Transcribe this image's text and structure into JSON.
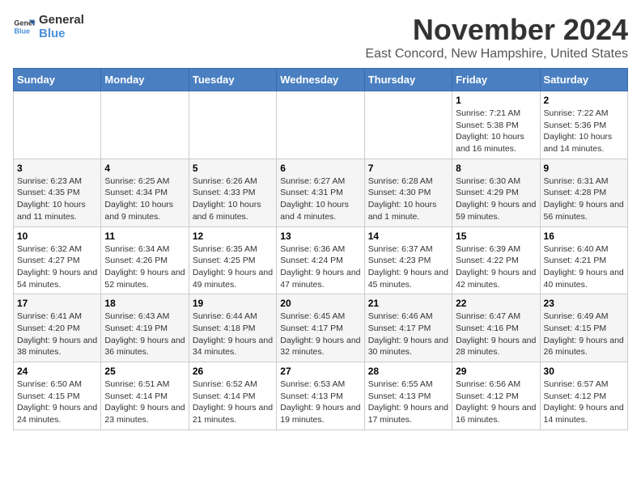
{
  "logo": {
    "line1": "General",
    "line2": "Blue"
  },
  "title": "November 2024",
  "location": "East Concord, New Hampshire, United States",
  "days_of_week": [
    "Sunday",
    "Monday",
    "Tuesday",
    "Wednesday",
    "Thursday",
    "Friday",
    "Saturday"
  ],
  "weeks": [
    [
      {
        "day": "",
        "info": ""
      },
      {
        "day": "",
        "info": ""
      },
      {
        "day": "",
        "info": ""
      },
      {
        "day": "",
        "info": ""
      },
      {
        "day": "",
        "info": ""
      },
      {
        "day": "1",
        "info": "Sunrise: 7:21 AM\nSunset: 5:38 PM\nDaylight: 10 hours and 16 minutes."
      },
      {
        "day": "2",
        "info": "Sunrise: 7:22 AM\nSunset: 5:36 PM\nDaylight: 10 hours and 14 minutes."
      }
    ],
    [
      {
        "day": "3",
        "info": "Sunrise: 6:23 AM\nSunset: 4:35 PM\nDaylight: 10 hours and 11 minutes."
      },
      {
        "day": "4",
        "info": "Sunrise: 6:25 AM\nSunset: 4:34 PM\nDaylight: 10 hours and 9 minutes."
      },
      {
        "day": "5",
        "info": "Sunrise: 6:26 AM\nSunset: 4:33 PM\nDaylight: 10 hours and 6 minutes."
      },
      {
        "day": "6",
        "info": "Sunrise: 6:27 AM\nSunset: 4:31 PM\nDaylight: 10 hours and 4 minutes."
      },
      {
        "day": "7",
        "info": "Sunrise: 6:28 AM\nSunset: 4:30 PM\nDaylight: 10 hours and 1 minute."
      },
      {
        "day": "8",
        "info": "Sunrise: 6:30 AM\nSunset: 4:29 PM\nDaylight: 9 hours and 59 minutes."
      },
      {
        "day": "9",
        "info": "Sunrise: 6:31 AM\nSunset: 4:28 PM\nDaylight: 9 hours and 56 minutes."
      }
    ],
    [
      {
        "day": "10",
        "info": "Sunrise: 6:32 AM\nSunset: 4:27 PM\nDaylight: 9 hours and 54 minutes."
      },
      {
        "day": "11",
        "info": "Sunrise: 6:34 AM\nSunset: 4:26 PM\nDaylight: 9 hours and 52 minutes."
      },
      {
        "day": "12",
        "info": "Sunrise: 6:35 AM\nSunset: 4:25 PM\nDaylight: 9 hours and 49 minutes."
      },
      {
        "day": "13",
        "info": "Sunrise: 6:36 AM\nSunset: 4:24 PM\nDaylight: 9 hours and 47 minutes."
      },
      {
        "day": "14",
        "info": "Sunrise: 6:37 AM\nSunset: 4:23 PM\nDaylight: 9 hours and 45 minutes."
      },
      {
        "day": "15",
        "info": "Sunrise: 6:39 AM\nSunset: 4:22 PM\nDaylight: 9 hours and 42 minutes."
      },
      {
        "day": "16",
        "info": "Sunrise: 6:40 AM\nSunset: 4:21 PM\nDaylight: 9 hours and 40 minutes."
      }
    ],
    [
      {
        "day": "17",
        "info": "Sunrise: 6:41 AM\nSunset: 4:20 PM\nDaylight: 9 hours and 38 minutes."
      },
      {
        "day": "18",
        "info": "Sunrise: 6:43 AM\nSunset: 4:19 PM\nDaylight: 9 hours and 36 minutes."
      },
      {
        "day": "19",
        "info": "Sunrise: 6:44 AM\nSunset: 4:18 PM\nDaylight: 9 hours and 34 minutes."
      },
      {
        "day": "20",
        "info": "Sunrise: 6:45 AM\nSunset: 4:17 PM\nDaylight: 9 hours and 32 minutes."
      },
      {
        "day": "21",
        "info": "Sunrise: 6:46 AM\nSunset: 4:17 PM\nDaylight: 9 hours and 30 minutes."
      },
      {
        "day": "22",
        "info": "Sunrise: 6:47 AM\nSunset: 4:16 PM\nDaylight: 9 hours and 28 minutes."
      },
      {
        "day": "23",
        "info": "Sunrise: 6:49 AM\nSunset: 4:15 PM\nDaylight: 9 hours and 26 minutes."
      }
    ],
    [
      {
        "day": "24",
        "info": "Sunrise: 6:50 AM\nSunset: 4:15 PM\nDaylight: 9 hours and 24 minutes."
      },
      {
        "day": "25",
        "info": "Sunrise: 6:51 AM\nSunset: 4:14 PM\nDaylight: 9 hours and 23 minutes."
      },
      {
        "day": "26",
        "info": "Sunrise: 6:52 AM\nSunset: 4:14 PM\nDaylight: 9 hours and 21 minutes."
      },
      {
        "day": "27",
        "info": "Sunrise: 6:53 AM\nSunset: 4:13 PM\nDaylight: 9 hours and 19 minutes."
      },
      {
        "day": "28",
        "info": "Sunrise: 6:55 AM\nSunset: 4:13 PM\nDaylight: 9 hours and 17 minutes."
      },
      {
        "day": "29",
        "info": "Sunrise: 6:56 AM\nSunset: 4:12 PM\nDaylight: 9 hours and 16 minutes."
      },
      {
        "day": "30",
        "info": "Sunrise: 6:57 AM\nSunset: 4:12 PM\nDaylight: 9 hours and 14 minutes."
      }
    ]
  ]
}
